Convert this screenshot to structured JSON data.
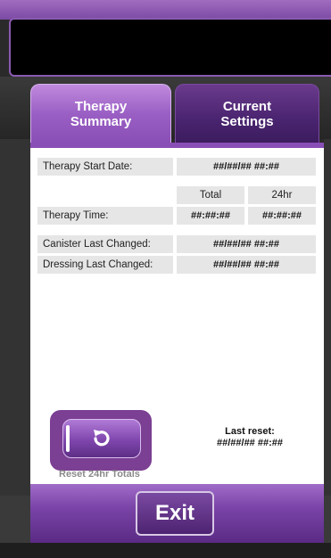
{
  "tabs": [
    {
      "label": "Therapy\nSummary",
      "active": true
    },
    {
      "label": "Current\nSettings",
      "active": false
    }
  ],
  "summary": {
    "therapy_start_date": {
      "label": "Therapy Start Date:",
      "value": "##/##/## ##:##"
    },
    "columns": {
      "total": "Total",
      "h24": "24hr"
    },
    "therapy_time": {
      "label": "Therapy Time:",
      "total": "##:##:##",
      "h24": "##:##:##"
    },
    "canister_last_changed": {
      "label": "Canister Last Changed:",
      "value": "##/##/## ##:##"
    },
    "dressing_last_changed": {
      "label": "Dressing Last Changed:",
      "value": "##/##/## ##:##"
    }
  },
  "reset": {
    "button_label": "Reset 24hr Totals",
    "icon": "reset-arrow-icon",
    "last_reset_label": "Last reset:",
    "last_reset_value": "##/##/## ##:##"
  },
  "footer": {
    "exit_label": "Exit"
  },
  "colors": {
    "accent": "#8a4fb6",
    "highlight": "#7b3f93",
    "display": "#000000"
  }
}
